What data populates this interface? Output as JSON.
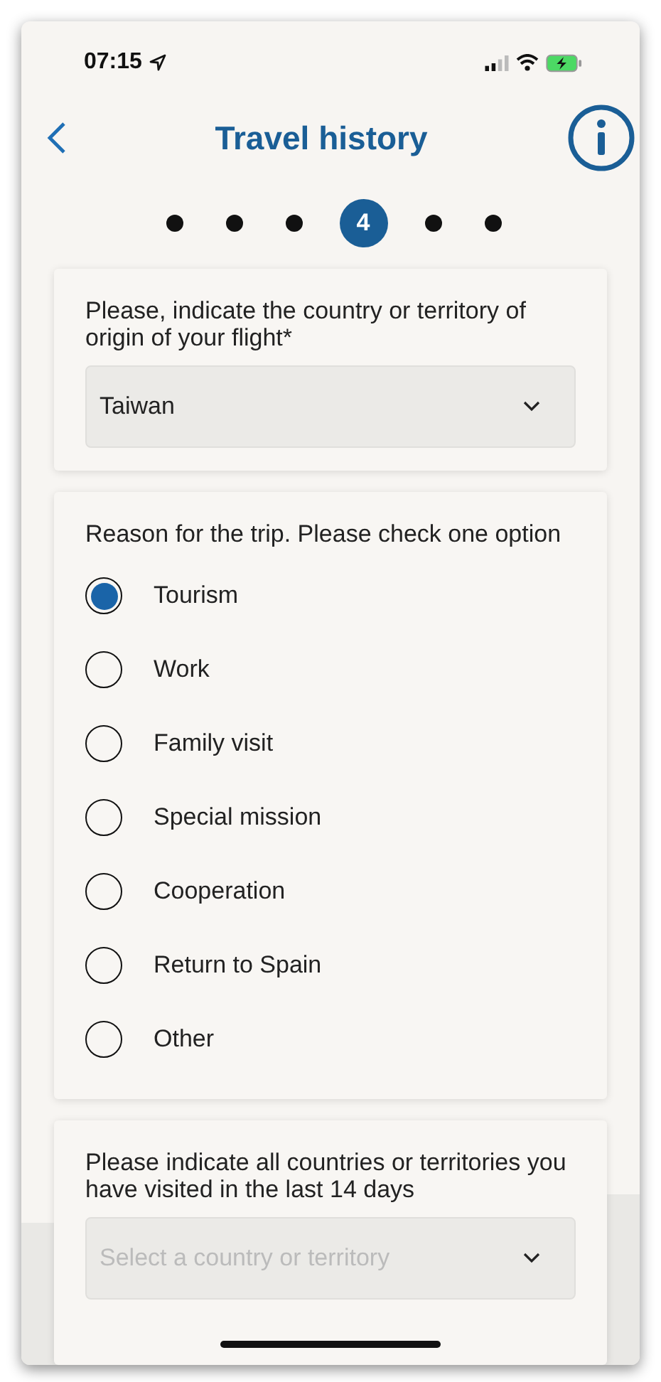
{
  "status_bar": {
    "time": "07:15"
  },
  "header": {
    "title": "Travel history"
  },
  "steps": [
    {
      "selected": false
    },
    {
      "selected": false
    },
    {
      "selected": false
    },
    {
      "selected": true,
      "label": "4"
    },
    {
      "selected": false
    },
    {
      "selected": false
    }
  ],
  "origin": {
    "label": "Please, indicate the country or territory of origin of your flight*",
    "value": "Taiwan"
  },
  "reason": {
    "label": "Reason for the trip. Please check one option",
    "options": [
      {
        "label": "Tourism",
        "selected": true
      },
      {
        "label": "Work",
        "selected": false
      },
      {
        "label": "Family visit",
        "selected": false
      },
      {
        "label": "Special mission",
        "selected": false
      },
      {
        "label": "Cooperation",
        "selected": false
      },
      {
        "label": "Return to Spain",
        "selected": false
      },
      {
        "label": "Other",
        "selected": false
      }
    ]
  },
  "visited": {
    "label": "Please indicate all countries or territories you have visited in the last 14 days",
    "placeholder": "Select a country or territory"
  }
}
